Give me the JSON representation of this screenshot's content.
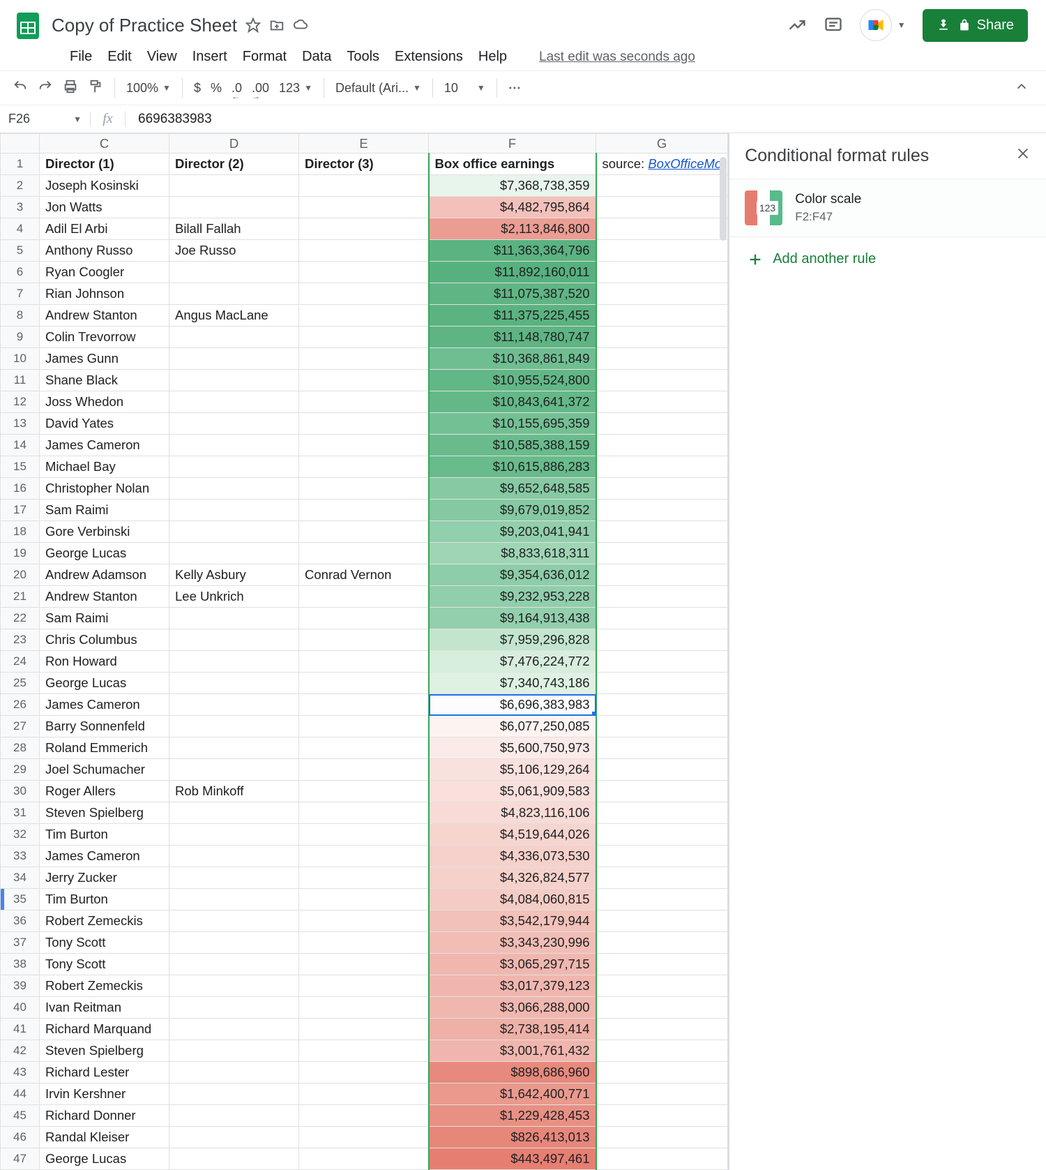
{
  "doc": {
    "title": "Copy of Practice Sheet",
    "last_edit": "Last edit was seconds ago"
  },
  "menu": {
    "file": "File",
    "edit": "Edit",
    "view": "View",
    "insert": "Insert",
    "format": "Format",
    "data": "Data",
    "tools": "Tools",
    "extensions": "Extensions",
    "help": "Help"
  },
  "toolbar": {
    "zoom": "100%",
    "currency": "$",
    "percent": "%",
    "dec_dec": ".0",
    "inc_dec": ".00",
    "num_fmt": "123",
    "font": "Default (Ari...",
    "font_size": "10"
  },
  "share": {
    "label": "Share"
  },
  "namebox": "F26",
  "fx_value": "6696383983",
  "columns": {
    "C": "C",
    "D": "D",
    "E": "E",
    "F": "F",
    "G": "G"
  },
  "headers": {
    "C": "Director (1)",
    "D": "Director (2)",
    "E": "Director (3)",
    "F": "Box office earnings",
    "G_prefix": "source: ",
    "G_link": "BoxOfficeMo"
  },
  "rows": [
    {
      "r": 2,
      "C": "Joseph Kosinski",
      "D": "",
      "E": "",
      "F": "$7,368,738,359",
      "bg": "#e8f5ec"
    },
    {
      "r": 3,
      "C": "Jon Watts",
      "D": "",
      "E": "",
      "F": "$4,482,795,864",
      "bg": "#f3c1ba"
    },
    {
      "r": 4,
      "C": "Adil El Arbi",
      "D": "Bilall Fallah",
      "E": "",
      "F": "$2,113,846,800",
      "bg": "#eb9d92"
    },
    {
      "r": 5,
      "C": "Anthony Russo",
      "D": "Joe Russo",
      "E": "",
      "F": "$11,363,364,796",
      "bg": "#5bb381"
    },
    {
      "r": 6,
      "C": "Ryan Coogler",
      "D": "",
      "E": "",
      "F": "$11,892,160,011",
      "bg": "#57b17e"
    },
    {
      "r": 7,
      "C": "Rian Johnson",
      "D": "",
      "E": "",
      "F": "$11,075,387,520",
      "bg": "#5fb584"
    },
    {
      "r": 8,
      "C": "Andrew Stanton",
      "D": "Angus MacLane",
      "E": "",
      "F": "$11,375,225,455",
      "bg": "#5bb381"
    },
    {
      "r": 9,
      "C": "Colin Trevorrow",
      "D": "",
      "E": "",
      "F": "$11,148,780,747",
      "bg": "#5eb483"
    },
    {
      "r": 10,
      "C": "James Gunn",
      "D": "",
      "E": "",
      "F": "$10,368,861,849",
      "bg": "#6fbe91"
    },
    {
      "r": 11,
      "C": "Shane Black",
      "D": "",
      "E": "",
      "F": "$10,955,524,800",
      "bg": "#62b786"
    },
    {
      "r": 12,
      "C": "Joss Whedon",
      "D": "",
      "E": "",
      "F": "$10,843,641,372",
      "bg": "#64b888"
    },
    {
      "r": 13,
      "C": "David Yates",
      "D": "",
      "E": "",
      "F": "$10,155,695,359",
      "bg": "#73c094"
    },
    {
      "r": 14,
      "C": "James Cameron",
      "D": "",
      "E": "",
      "F": "$10,585,388,159",
      "bg": "#69bb8c"
    },
    {
      "r": 15,
      "C": "Michael Bay",
      "D": "",
      "E": "",
      "F": "$10,615,886,283",
      "bg": "#68bb8b"
    },
    {
      "r": 16,
      "C": "Christopher Nolan",
      "D": "",
      "E": "",
      "F": "$9,652,648,585",
      "bg": "#86c9a2"
    },
    {
      "r": 17,
      "C": "Sam Raimi",
      "D": "",
      "E": "",
      "F": "$9,679,019,852",
      "bg": "#85c8a1"
    },
    {
      "r": 18,
      "C": "Gore Verbinski",
      "D": "",
      "E": "",
      "F": "$9,203,041,941",
      "bg": "#92cfac"
    },
    {
      "r": 19,
      "C": "George Lucas",
      "D": "",
      "E": "",
      "F": "$8,833,618,311",
      "bg": "#9fd5b5"
    },
    {
      "r": 20,
      "C": "Andrew Adamson",
      "D": "Kelly Asbury",
      "E": "Conrad Vernon",
      "F": "$9,354,636,012",
      "bg": "#8ecda9"
    },
    {
      "r": 21,
      "C": "Andrew Stanton",
      "D": "Lee Unkrich",
      "E": "",
      "F": "$9,232,953,228",
      "bg": "#91ceab"
    },
    {
      "r": 22,
      "C": "Sam Raimi",
      "D": "",
      "E": "",
      "F": "$9,164,913,438",
      "bg": "#93cfac"
    },
    {
      "r": 23,
      "C": "Chris Columbus",
      "D": "",
      "E": "",
      "F": "$7,959,296,828",
      "bg": "#c3e5ce"
    },
    {
      "r": 24,
      "C": "Ron Howard",
      "D": "",
      "E": "",
      "F": "$7,476,224,772",
      "bg": "#d8eedd"
    },
    {
      "r": 25,
      "C": "George Lucas",
      "D": "",
      "E": "",
      "F": "$7,340,743,186",
      "bg": "#def1e2"
    },
    {
      "r": 26,
      "C": "James Cameron",
      "D": "",
      "E": "",
      "F": "$6,696,383,983",
      "bg": "#fbfcfb"
    },
    {
      "r": 27,
      "C": "Barry Sonnenfeld",
      "D": "",
      "E": "",
      "F": "$6,077,250,085",
      "bg": "#fdf4f2"
    },
    {
      "r": 28,
      "C": "Roland Emmerich",
      "D": "",
      "E": "",
      "F": "$5,600,750,973",
      "bg": "#fbebe8"
    },
    {
      "r": 29,
      "C": "Joel Schumacher",
      "D": "",
      "E": "",
      "F": "$5,106,129,264",
      "bg": "#f9e1dd"
    },
    {
      "r": 30,
      "C": "Roger Allers",
      "D": "Rob Minkoff",
      "E": "",
      "F": "$5,061,909,583",
      "bg": "#f9e0dc"
    },
    {
      "r": 31,
      "C": "Steven Spielberg",
      "D": "",
      "E": "",
      "F": "$4,823,116,106",
      "bg": "#f8dbd6"
    },
    {
      "r": 32,
      "C": "Tim Burton",
      "D": "",
      "E": "",
      "F": "$4,519,644,026",
      "bg": "#f7d5cf"
    },
    {
      "r": 33,
      "C": "James Cameron",
      "D": "",
      "E": "",
      "F": "$4,336,073,530",
      "bg": "#f6d1cb"
    },
    {
      "r": 34,
      "C": "Jerry Zucker",
      "D": "",
      "E": "",
      "F": "$4,326,824,577",
      "bg": "#f6d1cb"
    },
    {
      "r": 35,
      "C": "Tim Burton",
      "D": "",
      "E": "",
      "F": "$4,084,060,815",
      "bg": "#f5ccc5"
    },
    {
      "r": 36,
      "C": "Robert Zemeckis",
      "D": "",
      "E": "",
      "F": "$3,542,179,944",
      "bg": "#f2c1b9"
    },
    {
      "r": 37,
      "C": "Tony Scott",
      "D": "",
      "E": "",
      "F": "$3,343,230,996",
      "bg": "#f1bdb5"
    },
    {
      "r": 38,
      "C": "Tony Scott",
      "D": "",
      "E": "",
      "F": "$3,065,297,715",
      "bg": "#f0b7af"
    },
    {
      "r": 39,
      "C": "Robert Zemeckis",
      "D": "",
      "E": "",
      "F": "$3,017,379,123",
      "bg": "#f0b6ae"
    },
    {
      "r": 40,
      "C": "Ivan Reitman",
      "D": "",
      "E": "",
      "F": "$3,066,288,000",
      "bg": "#f0b7af"
    },
    {
      "r": 41,
      "C": "Richard Marquand",
      "D": "",
      "E": "",
      "F": "$2,738,195,414",
      "bg": "#eeb0a7"
    },
    {
      "r": 42,
      "C": "Steven Spielberg",
      "D": "",
      "E": "",
      "F": "$3,001,761,432",
      "bg": "#f0b6ad"
    },
    {
      "r": 43,
      "C": "Richard Lester",
      "D": "",
      "E": "",
      "F": "$898,686,960",
      "bg": "#e7897c"
    },
    {
      "r": 44,
      "C": "Irvin Kershner",
      "D": "",
      "E": "",
      "F": "$1,642,400,771",
      "bg": "#ea998d"
    },
    {
      "r": 45,
      "C": "Richard Donner",
      "D": "",
      "E": "",
      "F": "$1,229,428,453",
      "bg": "#e89084"
    },
    {
      "r": 46,
      "C": "Randal Kleiser",
      "D": "",
      "E": "",
      "F": "$826,413,013",
      "bg": "#e7877a"
    },
    {
      "r": 47,
      "C": "George Lucas",
      "D": "",
      "E": "",
      "F": "$443,497,461",
      "bg": "#e67f72"
    }
  ],
  "sidepanel": {
    "title": "Conditional format rules",
    "rule": {
      "type": "Color scale",
      "range": "F2:F47",
      "swatch_label": "123",
      "colors": [
        "#e67c6f",
        "#ffffff",
        "#57bb8a"
      ]
    },
    "add": "Add another rule"
  }
}
